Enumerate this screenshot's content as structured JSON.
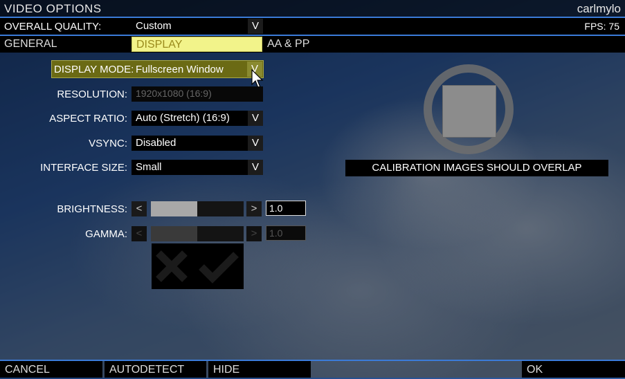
{
  "window": {
    "title": "VIDEO OPTIONS",
    "user": "carlmylo"
  },
  "quality": {
    "label": "OVERALL QUALITY:",
    "value": "Custom",
    "fps": "FPS: 75"
  },
  "tabs": [
    {
      "label": "GENERAL"
    },
    {
      "label": "DISPLAY",
      "active": true
    },
    {
      "label": "AA & PP"
    }
  ],
  "settings": {
    "display_mode": {
      "label": "DISPLAY MODE:",
      "value": "Fullscreen Window"
    },
    "resolution": {
      "label": "RESOLUTION:",
      "value": "1920x1080 (16:9)"
    },
    "aspect_ratio": {
      "label": "ASPECT RATIO:",
      "value": "Auto (Stretch) (16:9)"
    },
    "vsync": {
      "label": "VSYNC:",
      "value": "Disabled"
    },
    "interface_size": {
      "label": "INTERFACE SIZE:",
      "value": "Small"
    },
    "brightness": {
      "label": "BRIGHTNESS:",
      "value": "1.0",
      "fill_fraction": 0.5
    },
    "gamma": {
      "label": "GAMMA:",
      "value": "1.0",
      "fill_fraction": 0.5
    }
  },
  "glyphs": {
    "dropdown_arrow": "V",
    "decrease": "<",
    "increase": ">"
  },
  "calibration": {
    "text": "CALIBRATION IMAGES SHOULD OVERLAP"
  },
  "footer": {
    "cancel": "CANCEL",
    "autodetect": "AUTODETECT",
    "hide": "HIDE",
    "ok": "OK"
  },
  "colors": {
    "accent_blue": "#3b7bd8",
    "tab_active_bg": "#f2f38a",
    "highlight_row": "#6b6a14"
  }
}
